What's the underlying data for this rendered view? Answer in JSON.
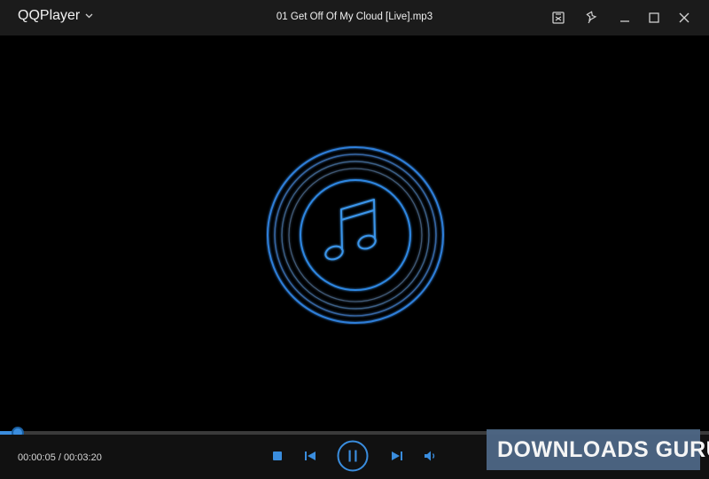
{
  "app": {
    "name": "QQPlayer",
    "menu_icon": "chevron-down-icon"
  },
  "titlebar": {
    "track_title": "01 Get Off Of My Cloud [Live].mp3",
    "buttons": [
      "screenshot-icon",
      "pin-icon",
      "minimize-icon",
      "maximize-icon",
      "close-icon"
    ]
  },
  "stage": {
    "artwork_icon": "music-note-icon",
    "accent": "#3a8dde"
  },
  "playback": {
    "elapsed": "00:00:05",
    "duration": "00:03:20",
    "time_display": "00:00:05 / 00:03:20",
    "progress_fraction": 0.025,
    "controls": [
      "stop-icon",
      "previous-icon",
      "pause-icon",
      "next-icon",
      "volume-icon"
    ]
  },
  "watermark": {
    "text": "DOWNLOADS GURU"
  },
  "colors": {
    "titlebar_bg": "#1b1b1b",
    "accent": "#3a8dde",
    "background": "#000000"
  }
}
